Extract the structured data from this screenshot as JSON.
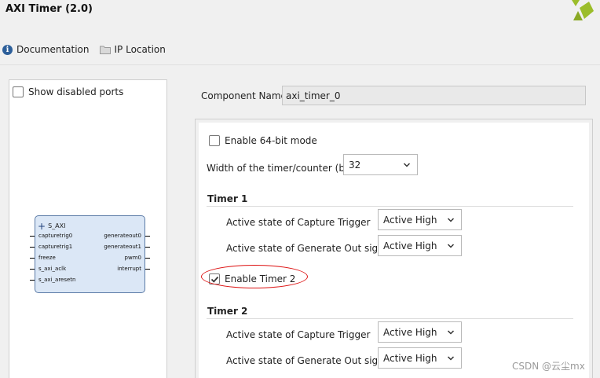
{
  "window": {
    "title": "AXI Timer (2.0)"
  },
  "toolbar": {
    "documentation_label": "Documentation",
    "ip_location_label": "IP Location"
  },
  "left_panel": {
    "show_disabled_ports_label": "Show disabled ports",
    "show_disabled_ports_checked": false,
    "block": {
      "bus_label": "S_AXI",
      "left_ports": [
        "capturetrig0",
        "capturetrig1",
        "freeze",
        "s_axi_aclk",
        "s_axi_aresetn"
      ],
      "right_ports": [
        "generateout0",
        "generateout1",
        "pwm0",
        "interrupt"
      ]
    }
  },
  "component": {
    "label": "Component Name",
    "value": "axi_timer_0"
  },
  "settings": {
    "enable_64bit_label": "Enable 64-bit mode",
    "enable_64bit_checked": false,
    "width_label": "Width of the timer/counter (bits)",
    "width_value": "32",
    "timer1": {
      "title": "Timer 1",
      "capture_label": "Active state of Capture Trigger",
      "capture_value": "Active High",
      "generate_label": "Active state of Generate Out signal",
      "generate_value": "Active High"
    },
    "enable_timer2_label": "Enable Timer 2",
    "enable_timer2_checked": true,
    "timer2": {
      "title": "Timer 2",
      "capture_label": "Active state of Capture Trigger",
      "capture_value": "Active High",
      "generate_label": "Active state of Generate Out signal",
      "generate_value": "Active High"
    }
  },
  "watermark": "CSDN @云尘mx",
  "colors": {
    "logo": "#9bbd2a",
    "annotation": "#dd1111",
    "block_fill": "#dbe7f6",
    "block_border": "#5a7aa6"
  }
}
